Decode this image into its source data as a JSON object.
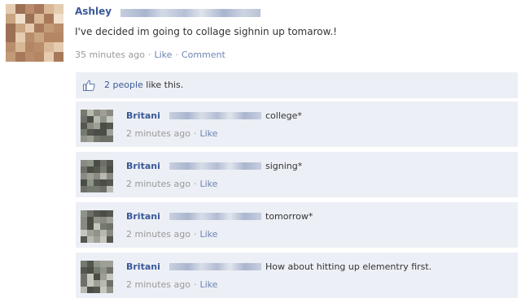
{
  "post": {
    "author": "Ashley",
    "text": "I've decided im going to collage sighnin up tomarow.!",
    "time": "35 minutes ago",
    "like_label": "Like",
    "comment_label": "Comment"
  },
  "likes": {
    "count_text": "2 people",
    "suffix": " like this."
  },
  "comments": [
    {
      "author": "Britani",
      "text": "college*",
      "time": "2 minutes ago",
      "like_label": "Like"
    },
    {
      "author": "Britani",
      "text": "signing*",
      "time": "2 minutes ago",
      "like_label": "Like"
    },
    {
      "author": "Britani",
      "text": "tomorrow*",
      "time": "2 minutes ago",
      "like_label": "Like"
    },
    {
      "author": "Britani",
      "text": "How about hitting up elementry first.",
      "time": "2 minutes ago",
      "like_label": "Like"
    }
  ],
  "separator": "·",
  "colors": {
    "link": "#3b5998",
    "meta_link": "#6d84b4",
    "comment_bg": "#eceff5",
    "meta_text": "#999999"
  }
}
